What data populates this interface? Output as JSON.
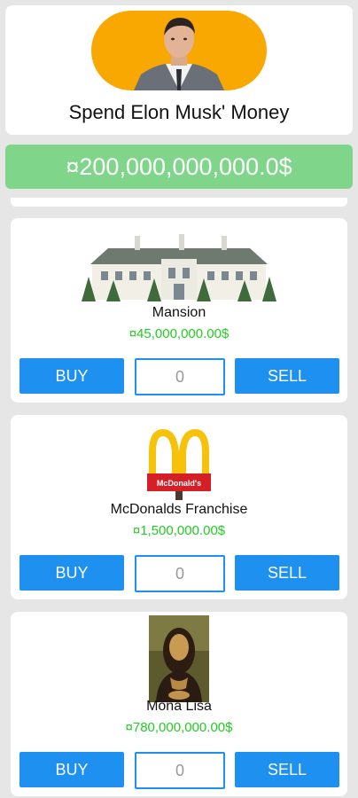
{
  "header": {
    "title": "Spend Elon Musk' Money",
    "avatar_color": "#f8a800"
  },
  "balance": {
    "value": "¤200,000,000,000.0$",
    "color": "#7fd68a"
  },
  "items": [
    {
      "icon": "mansion-image",
      "name": "Mansion",
      "price": "¤45,000,000.00$",
      "buy_label": "BUY",
      "quantity": "0",
      "sell_label": "SELL"
    },
    {
      "icon": "mcdonalds-sign-image",
      "name": "McDonalds Franchise",
      "price": "¤1,500,000.00$",
      "buy_label": "BUY",
      "quantity": "0",
      "sell_label": "SELL"
    },
    {
      "icon": "mona-lisa-image",
      "name": "Mona Lisa",
      "price": "¤780,000,000.00$",
      "buy_label": "BUY",
      "quantity": "0",
      "sell_label": "SELL"
    }
  ],
  "colors": {
    "button": "#1e90f0",
    "price": "#22cc22"
  }
}
